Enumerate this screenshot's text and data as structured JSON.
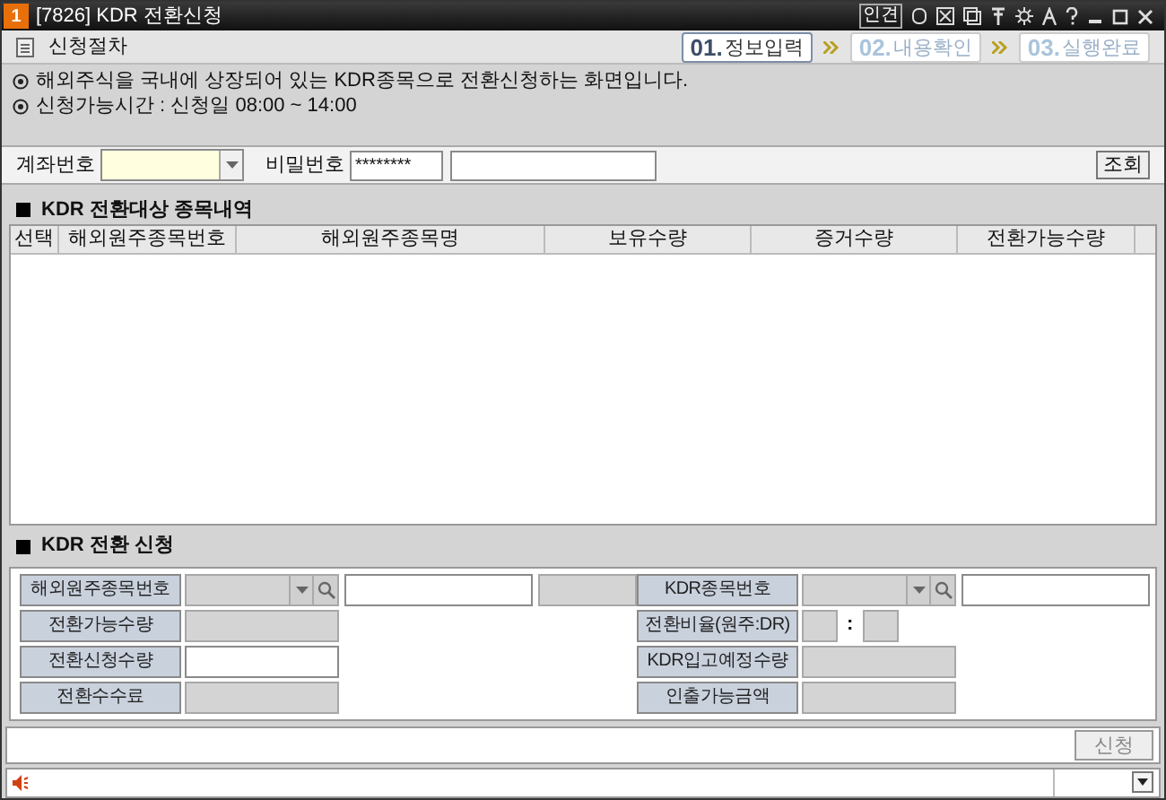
{
  "window": {
    "badge": "1",
    "title": "[7826] KDR 전환신청",
    "toolbar_label": "인견"
  },
  "steps_header": {
    "title": "신청절차",
    "steps": [
      {
        "number": "01.",
        "label": "정보입력",
        "selected": true
      },
      {
        "number": "02.",
        "label": "내용확인",
        "selected": false
      },
      {
        "number": "03.",
        "label": "실행완료",
        "selected": false
      }
    ]
  },
  "notices": [
    "해외주식을 국내에 상장되어 있는 KDR종목으로 전환신청하는 화면입니다.",
    "신청가능시간 : 신청일 08:00 ~ 14:00"
  ],
  "account": {
    "account_label": "계좌번호",
    "password_label": "비밀번호",
    "password_value": "********",
    "query_button": "조회"
  },
  "holdings": {
    "title": "KDR 전환대상 종목내역",
    "columns": [
      "선택",
      "해외원주종목번호",
      "해외원주종목명",
      "보유수량",
      "증거수량",
      "전환가능수량"
    ]
  },
  "application": {
    "title": "KDR 전환 신청",
    "fields_left": [
      {
        "label": "해외원주종목번호",
        "kind": "lookup"
      },
      {
        "label": "전환가능수량",
        "kind": "readonly"
      },
      {
        "label": "전환신청수량",
        "kind": "input"
      },
      {
        "label": "전환수수료",
        "kind": "readonly"
      }
    ],
    "fields_right": [
      {
        "label": "KDR종목번호",
        "kind": "lookup"
      },
      {
        "label": "전환비율(원주:DR)",
        "kind": "ratio",
        "separator": ":"
      },
      {
        "label": "KDR입고예정수량",
        "kind": "readonly"
      },
      {
        "label": "인출가능금액",
        "kind": "readonly"
      }
    ],
    "submit_button": "신청"
  }
}
